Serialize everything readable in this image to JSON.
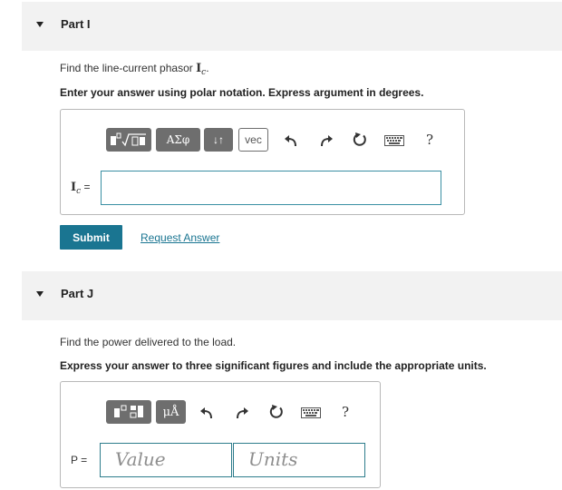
{
  "part_i": {
    "title": "Part I",
    "question_prefix": "Find the line-current phasor ",
    "phasor_symbol": "I",
    "phasor_sub": "c",
    "question_suffix": ".",
    "instruction": "Enter your answer using polar notation. Express argument in degrees.",
    "toolbar": {
      "templates_label": "templates",
      "greek_label": "ΑΣφ",
      "arrows_label": "↓↑",
      "vec_label": "vec",
      "help_label": "?"
    },
    "input_label_symbol": "I",
    "input_label_sub": "c",
    "input_label_eq": "=",
    "input_value": "",
    "submit_label": "Submit",
    "request_label": "Request Answer"
  },
  "part_j": {
    "title": "Part J",
    "question": "Find the power delivered to the load.",
    "instruction": "Express your answer to three significant figures and include the appropriate units.",
    "toolbar": {
      "units_label": "μÅ",
      "help_label": "?"
    },
    "input_label": "P =",
    "value_placeholder": "Value",
    "units_placeholder": "Units"
  },
  "colors": {
    "header_bg": "#f2f2f2",
    "toolbar_button": "#6e6e6e",
    "accent": "#1a7591",
    "field_border": "#2e7d8c"
  }
}
